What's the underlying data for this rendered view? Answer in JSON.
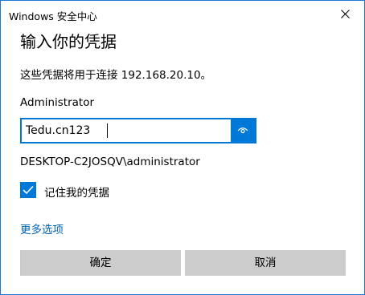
{
  "window": {
    "title": "Windows 安全中心",
    "close_icon": "close-icon"
  },
  "dialog": {
    "heading": "输入你的凭据",
    "description": "这些凭据将用于连接 192.168.20.10。",
    "username": "Administrator",
    "password_value": "Tedu.cn123",
    "reveal_icon": "eye-icon",
    "domain_user": "DESKTOP-C2JOSQV\\administrator",
    "remember_label": "记住我的凭据",
    "remember_checked": true,
    "more_options": "更多选项"
  },
  "buttons": {
    "ok": "确定",
    "cancel": "取消"
  },
  "colors": {
    "accent": "#0078d7",
    "link": "#0063b1",
    "button_bg": "#cccccc",
    "border": "#1e78d7"
  }
}
